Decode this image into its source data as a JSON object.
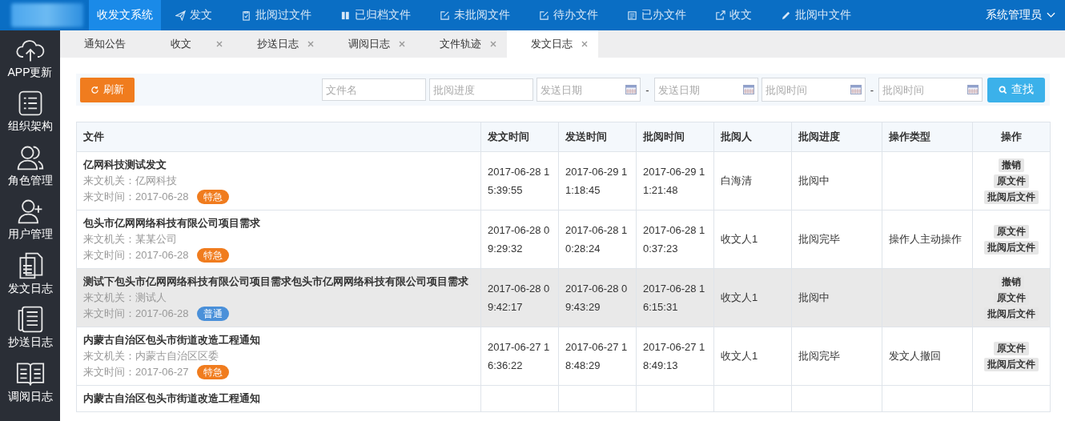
{
  "top_nav": {
    "items": [
      {
        "label": "收发文系统",
        "selected": true
      },
      {
        "label": "发文",
        "selected": false
      },
      {
        "label": "批阅过文件",
        "selected": false
      },
      {
        "label": "已归档文件",
        "selected": false
      },
      {
        "label": "未批阅文件",
        "selected": false
      },
      {
        "label": "待办文件",
        "selected": false
      },
      {
        "label": "已办文件",
        "selected": false
      },
      {
        "label": "收文",
        "selected": false
      },
      {
        "label": "批阅中文件",
        "selected": false
      }
    ],
    "user": "系统管理员"
  },
  "sidebar": {
    "items": [
      {
        "label": "APP更新"
      },
      {
        "label": "组织架构"
      },
      {
        "label": "角色管理"
      },
      {
        "label": "用户管理"
      },
      {
        "label": "发文日志"
      },
      {
        "label": "抄送日志"
      },
      {
        "label": "调阅日志"
      }
    ]
  },
  "tabs": [
    {
      "label": "通知公告",
      "selected": false,
      "closable": false
    },
    {
      "label": "收文",
      "selected": false,
      "closable": true
    },
    {
      "label": "抄送日志",
      "selected": false,
      "closable": true
    },
    {
      "label": "调阅日志",
      "selected": false,
      "closable": true
    },
    {
      "label": "文件轨迹",
      "selected": false,
      "closable": true
    },
    {
      "label": "发文日志",
      "selected": true,
      "closable": true
    }
  ],
  "toolbar": {
    "refresh": "刷新",
    "filters": [
      {
        "kind": "text",
        "placeholder": "文件名"
      },
      {
        "kind": "text",
        "placeholder": "批阅进度"
      },
      {
        "kind": "date",
        "placeholder": "发送日期"
      },
      {
        "kind": "separator",
        "label": "-"
      },
      {
        "kind": "date",
        "placeholder": "发送日期"
      },
      {
        "kind": "date",
        "placeholder": "批阅时间"
      },
      {
        "kind": "separator",
        "label": "-"
      },
      {
        "kind": "date",
        "placeholder": "批阅时间"
      }
    ],
    "search": "查找"
  },
  "table": {
    "columns": [
      "文件",
      "发文时间",
      "发送时间",
      "批阅时间",
      "批阅人",
      "批阅进度",
      "操作类型",
      "操作"
    ],
    "rows": [
      {
        "selected": false,
        "title": "亿网科技测试发文",
        "source": "来文机关：亿网科技",
        "date": "来文时间：2017-06-28",
        "badge": {
          "label": "特急",
          "color": "#f07c1e"
        },
        "sent_doc_time": "2017-06-28 15:39:55",
        "send_time": "2017-06-29 11:18:45",
        "review_time": "2017-06-29 11:21:48",
        "reviewer": "白海清",
        "progress": "批阅中",
        "op_type": "",
        "actions": [
          "撤销",
          "原文件",
          "批阅后文件"
        ]
      },
      {
        "selected": false,
        "title": "包头市亿网网络科技有限公司项目需求",
        "source": "来文机关：某某公司",
        "date": "来文时间：2017-06-28",
        "badge": {
          "label": "特急",
          "color": "#f07c1e"
        },
        "sent_doc_time": "2017-06-28 09:29:32",
        "send_time": "2017-06-28 10:28:24",
        "review_time": "2017-06-28 10:37:23",
        "reviewer": "收文人1",
        "progress": "批阅完毕",
        "op_type": "操作人主动操作",
        "actions": [
          "原文件",
          "批阅后文件"
        ]
      },
      {
        "selected": true,
        "title": "测试下包头市亿网网络科技有限公司项目需求包头市亿网网络科技有限公司项目需求",
        "source": "来文机关：测试人",
        "date": "来文时间：2017-06-28",
        "badge": {
          "label": "普通",
          "color": "#4a90d9"
        },
        "sent_doc_time": "2017-06-28 09:42:17",
        "send_time": "2017-06-28 09:43:29",
        "review_time": "2017-06-28 16:15:31",
        "reviewer": "收文人1",
        "progress": "批阅中",
        "op_type": "",
        "actions": [
          "撤销",
          "原文件",
          "批阅后文件"
        ]
      },
      {
        "selected": false,
        "title": "内蒙古自治区包头市街道改造工程通知",
        "source": "来文机关：内蒙古自治区区委",
        "date": "来文时间：2017-06-27",
        "badge": {
          "label": "特急",
          "color": "#f07c1e"
        },
        "sent_doc_time": "2017-06-27 16:36:22",
        "send_time": "2017-06-27 18:48:29",
        "review_time": "2017-06-27 18:49:13",
        "reviewer": "收文人1",
        "progress": "批阅完毕",
        "op_type": "发文人撤回",
        "actions": [
          "原文件",
          "批阅后文件"
        ]
      },
      {
        "selected": false,
        "title": "内蒙古自治区包头市街道改造工程通知"
      }
    ]
  }
}
